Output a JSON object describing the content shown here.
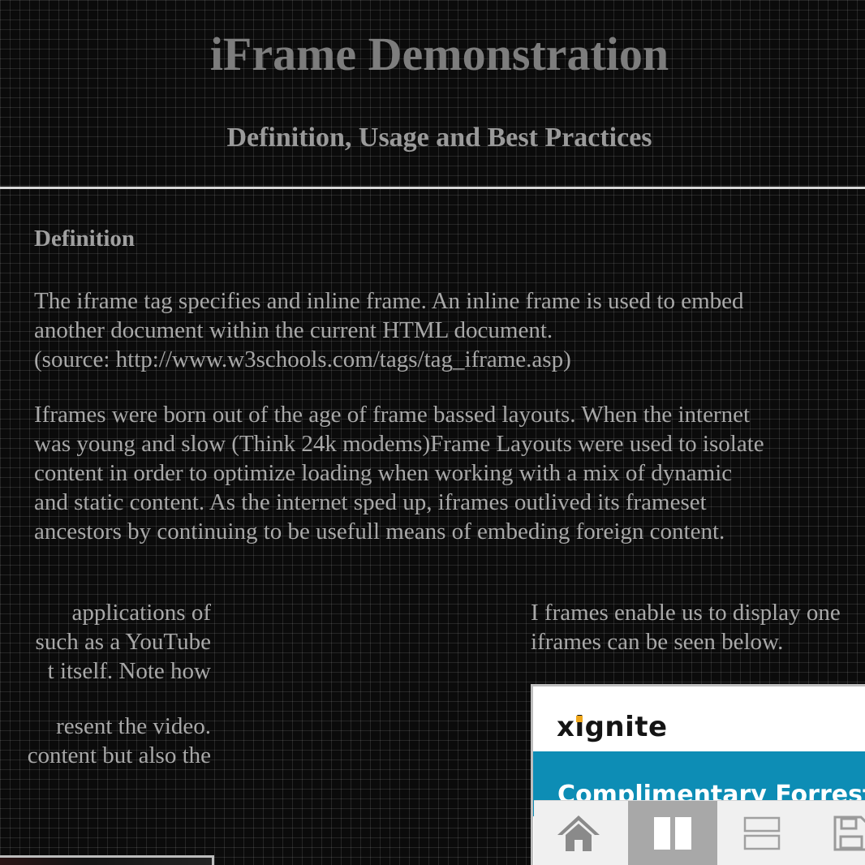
{
  "header": {
    "title": "iFrame Demonstration",
    "subtitle": "Definition, Usage and Best Practices"
  },
  "definition": {
    "heading": "Definition",
    "paragraph1": "The iframe tag specifies and inline frame. An inline frame is used to embed\nanother document within the current HTML document.\n(source: http://www.w3schools.com/tags/tag_iframe.asp)",
    "paragraph2": "Iframes were born out of the age of frame bassed layouts. When the internet\nwas young and slow (Think 24k modems)Frame Layouts were used to isolate\ncontent in order to optimize loading when working with a mix of dynamic\nand static content. As the internet sped up, iframes outlived its frameset\nancestors by continuing to be usefull means of embeding foreign content."
  },
  "left_column": {
    "lines": [
      "applications of",
      "such as a YouTube",
      "t itself. Note how",
      "resent the video.",
      "content but also the"
    ]
  },
  "right_column": {
    "lines": [
      "I frames enable us to display one",
      "iframes can be seen below."
    ]
  },
  "embedded_page": {
    "logo_text_before": "x",
    "logo_text_i": "i",
    "logo_text_after": "gnite",
    "banner_text": "Complimentary Forrester",
    "brand_accent": "#f0a81c",
    "banner_color": "#0d8db5"
  },
  "toolbar": {
    "buttons": [
      {
        "name": "home",
        "icon": "home-icon",
        "active": false
      },
      {
        "name": "split-vertical",
        "icon": "split-vertical-icon",
        "active": true
      },
      {
        "name": "split-horizontal",
        "icon": "split-horizontal-icon",
        "active": false
      },
      {
        "name": "save",
        "icon": "save-icon",
        "active": false
      }
    ]
  }
}
